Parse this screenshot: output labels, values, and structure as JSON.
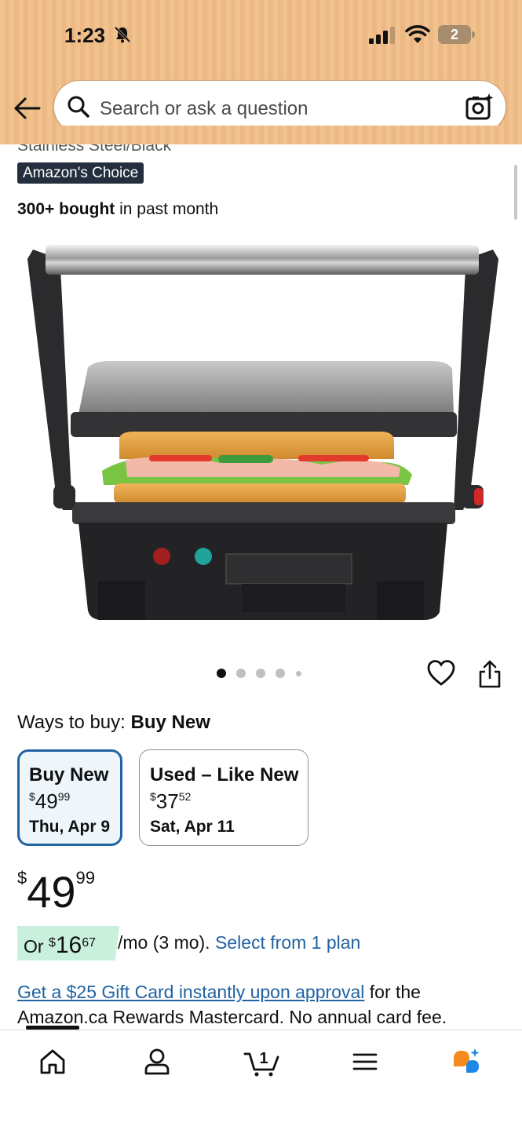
{
  "status_bar": {
    "time": "1:23",
    "battery": "2"
  },
  "search": {
    "placeholder": "Search or ask a question"
  },
  "product": {
    "subtitle_partial": "Stainless Steel/Black",
    "badge": "Amazon's Choice",
    "bought_bold": "300+ bought",
    "bought_rest": " in past month"
  },
  "image_carousel": {
    "total": 5,
    "active_index": 0
  },
  "ways_to_buy": {
    "label": "Ways to buy: ",
    "selected": "Buy New"
  },
  "options": [
    {
      "title": "Buy New",
      "currency": "$",
      "whole": "49",
      "fraction": "99",
      "date": "Thu, Apr 9",
      "selected": true
    },
    {
      "title": "Used – Like New",
      "currency": "$",
      "whole": "37",
      "fraction": "52",
      "date": "Sat, Apr 11",
      "selected": false
    }
  ],
  "price": {
    "currency": "$",
    "whole": "49",
    "fraction": "99"
  },
  "installment": {
    "prefix": "Or ",
    "currency": "$",
    "whole": "16",
    "fraction": "67",
    "suffix": "/mo (3 mo). ",
    "link": "Select from 1 plan"
  },
  "gift_card": {
    "link": "Get a $25 Gift Card instantly upon approval",
    "rest": " for the Amazon.ca Rewards Mastercard. No annual card fee."
  },
  "bottom_nav": {
    "items": [
      "home-icon",
      "account-icon",
      "cart-icon",
      "menu-icon",
      "rufus-icon"
    ],
    "cart_count": "1",
    "accent_colors": {
      "rufus_orange": "#f48b1e",
      "rufus_blue": "#1e88e5"
    }
  },
  "colors": {
    "header": "#f1c28e",
    "link": "#2162a1",
    "badge_bg": "#232f3e",
    "selected_border": "#2162a1",
    "installment_bg": "#c8f0dc"
  }
}
